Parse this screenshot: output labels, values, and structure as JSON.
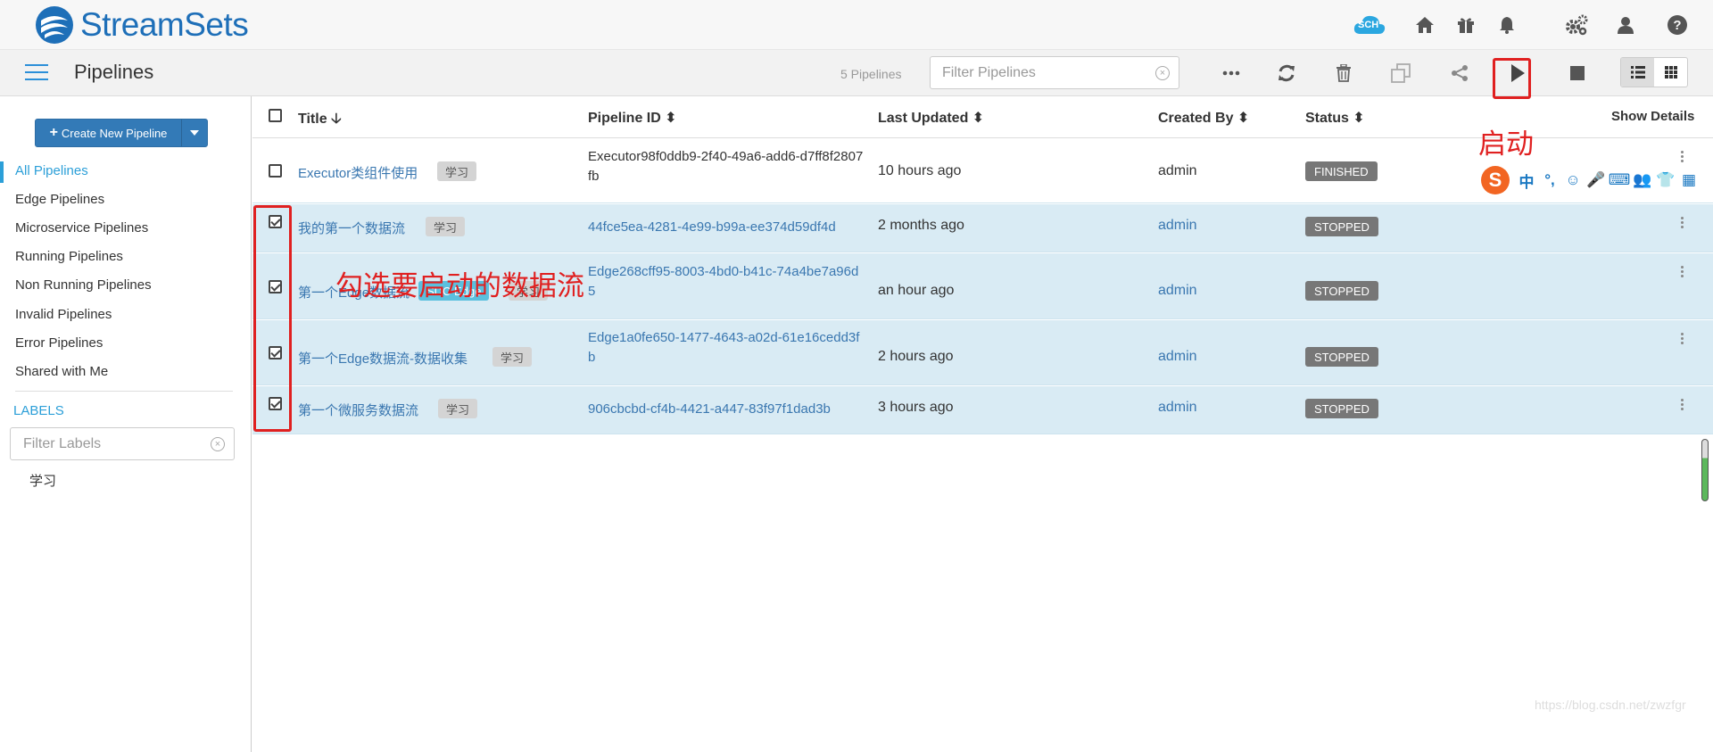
{
  "app": {
    "logo_text": "StreamSets"
  },
  "header": {
    "icons": [
      "sch-cloud-icon",
      "home-icon",
      "gift-icon",
      "bell-icon",
      "gears-icon",
      "user-icon",
      "help-icon"
    ],
    "sch_label": "SCH"
  },
  "toolbar": {
    "page_title": "Pipelines",
    "pipeline_count": "5 Pipelines",
    "filter_placeholder": "Filter Pipelines"
  },
  "sidebar": {
    "create_button": "Create New Pipeline",
    "items": [
      {
        "label": "All Pipelines",
        "active": true
      },
      {
        "label": "Edge Pipelines"
      },
      {
        "label": "Microservice Pipelines"
      },
      {
        "label": "Running Pipelines"
      },
      {
        "label": "Non Running Pipelines"
      },
      {
        "label": "Invalid Pipelines"
      },
      {
        "label": "Error Pipelines"
      },
      {
        "label": "Shared with Me"
      }
    ],
    "labels_heading": "LABELS",
    "filter_labels_placeholder": "Filter Labels",
    "label_items": [
      "学习"
    ]
  },
  "table": {
    "columns": [
      "Title",
      "Pipeline ID",
      "Last Updated",
      "Created By",
      "Status",
      "Show Details"
    ],
    "rows": [
      {
        "title": "Executor类组件使用",
        "tags": [
          "学习"
        ],
        "pipeline_id": "Executor98f0ddb9-2f40-49a6-add6-d7ff8f2807fb",
        "last_updated": "10 hours ago",
        "created_by": "admin",
        "status": "FINISHED",
        "selected": false
      },
      {
        "title": "我的第一个数据流",
        "tags": [
          "学习"
        ],
        "pipeline_id": "44fce5ea-4281-4e99-b99a-ee374d59df4d",
        "last_updated": "2 months ago",
        "created_by": "admin",
        "status": "STOPPED",
        "selected": true
      },
      {
        "title": "第一个Edge数据流",
        "tags": [
          "SDC Edge",
          "学习"
        ],
        "pipeline_id": "Edge268cff95-8003-4bd0-b41c-74a4be7a96d5",
        "last_updated": "an hour ago",
        "created_by": "admin",
        "status": "STOPPED",
        "selected": true
      },
      {
        "title": "第一个Edge数据流-数据收集",
        "tags": [
          "学习"
        ],
        "pipeline_id": "Edge1a0fe650-1477-4643-a02d-61e16cedd3fb",
        "last_updated": "2 hours ago",
        "created_by": "admin",
        "status": "STOPPED",
        "selected": true
      },
      {
        "title": "第一个微服务数据流",
        "tags": [
          "学习"
        ],
        "pipeline_id": "906cbcbd-cf4b-4421-a447-83f97f1dad3b",
        "last_updated": "3 hours ago",
        "created_by": "admin",
        "status": "STOPPED",
        "selected": true
      }
    ]
  },
  "annotations": {
    "start_label": "启动",
    "select_label": "勾选要启动的数据流"
  },
  "ime": {
    "logo": "S",
    "items": [
      "中",
      "°,",
      "☺",
      "🎤",
      "⌨",
      "👥",
      "👕",
      "▦"
    ]
  },
  "watermark": "https://blog.csdn.net/zwzfgr",
  "colors": {
    "brand": "#1e6fb8",
    "primary_button": "#337ab7",
    "accent": "#2c9fd8",
    "selected_row": "#d9ebf4",
    "annotation": "#e02020",
    "status_badge": "#777777"
  }
}
